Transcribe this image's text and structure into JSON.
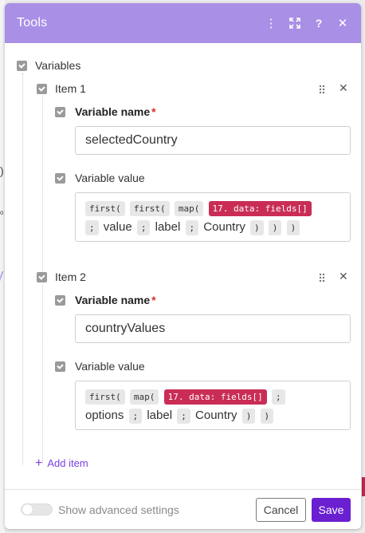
{
  "header": {
    "title": "Tools"
  },
  "variables": {
    "label": "Variables",
    "items": [
      {
        "title": "Item 1",
        "name_label": "Variable name",
        "name_required": "*",
        "name_value": "selectedCountry",
        "value_label": "Variable value",
        "value_line1": [
          "first(",
          "first(",
          "map(",
          "17. data: fields[]"
        ],
        "value_line2": [
          ";",
          "value",
          ";",
          "label",
          ";",
          "Country",
          ")",
          ")",
          ")"
        ]
      },
      {
        "title": "Item 2",
        "name_label": "Variable name",
        "name_required": "*",
        "name_value": "countryValues",
        "value_label": "Variable value",
        "value_line1": [
          "first(",
          "map(",
          "17. data: fields[]",
          ";"
        ],
        "value_line2": [
          "options",
          ";",
          "label",
          ";",
          "Country",
          ")",
          ")"
        ]
      }
    ],
    "add_item": "Add item"
  },
  "footer": {
    "advanced_label": "Show advanced settings",
    "advanced_on": false,
    "cancel": "Cancel",
    "save": "Save"
  },
  "colors": {
    "header": "#a98fe6",
    "accent": "#6a1fd1",
    "pill_red": "#c92d55",
    "required": "#d0312d"
  },
  "icons": [
    "more-vertical-icon",
    "expand-icon",
    "help-icon",
    "close-icon",
    "drag-handle-icon",
    "remove-icon",
    "plus-icon",
    "checkbox-icon"
  ]
}
